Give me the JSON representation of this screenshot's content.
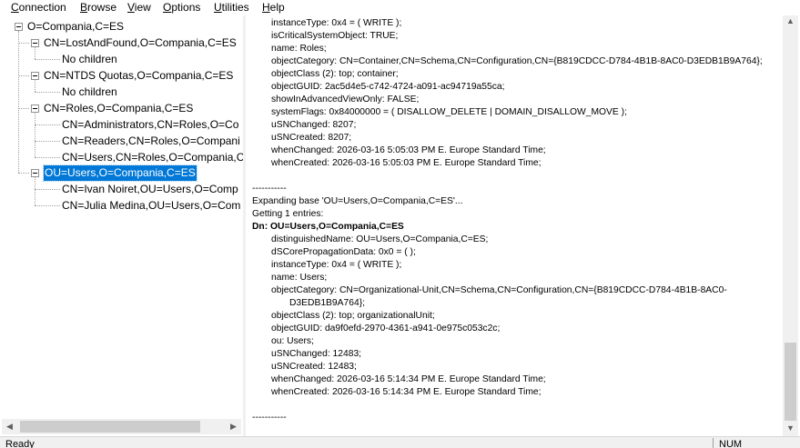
{
  "menu": [
    "Connection",
    "Browse",
    "View",
    "Options",
    "Utilities",
    "Help"
  ],
  "tree": {
    "root": "O=Compania,C=ES",
    "lostfound": "CN=LostAndFound,O=Compania,C=ES",
    "lostfound_child": "No children",
    "ntds": "CN=NTDS Quotas,O=Compania,C=ES",
    "ntds_child": "No children",
    "roles": "CN=Roles,O=Compania,C=ES",
    "roles_admins": "CN=Administrators,CN=Roles,O=Co",
    "roles_readers": "CN=Readers,CN=Roles,O=Compani",
    "roles_users": "CN=Users,CN=Roles,O=Compania,C",
    "users": "OU=Users,O=Compania,C=ES",
    "users_ivan": "CN=Ivan Noiret,OU=Users,O=Comp",
    "users_julia": "CN=Julia Medina,OU=Users,O=Com"
  },
  "output": {
    "lines": [
      "instanceType: 0x4 = ( WRITE );",
      "isCriticalSystemObject: TRUE;",
      "name: Roles;",
      "objectCategory: CN=Container,CN=Schema,CN=Configuration,CN={B819CDCC-D784-4B1B-8AC0-D3EDB1B9A764};",
      "objectClass (2): top; container;",
      "objectGUID: 2ac5d4e5-c742-4724-a091-ac94719a55ca;",
      "showInAdvancedViewOnly: FALSE;",
      "systemFlags: 0x84000000 = ( DISALLOW_DELETE | DOMAIN_DISALLOW_MOVE );",
      "uSNChanged: 8207;",
      "uSNCreated: 8207;",
      "whenChanged: 2026-03-16 5:05:03 PM E. Europe Standard Time;",
      "whenCreated: 2026-03-16 5:05:03 PM E. Europe Standard Time;",
      "-----------",
      "Expanding base 'OU=Users,O=Compania,C=ES'...",
      "Getting 1 entries:",
      "Dn: OU=Users,O=Compania,C=ES",
      "distinguishedName: OU=Users,O=Compania,C=ES;",
      "dSCorePropagationData: 0x0 = (  );",
      "instanceType: 0x4 = ( WRITE );",
      "name: Users;",
      "objectCategory: CN=Organizational-Unit,CN=Schema,CN=Configuration,CN={B819CDCC-D784-4B1B-8AC0-",
      "D3EDB1B9A764};",
      "objectClass (2): top; organizationalUnit;",
      "objectGUID: da9f0efd-2970-4361-a941-0e975c053c2c;",
      "ou: Users;",
      "uSNChanged: 12483;",
      "uSNCreated: 12483;",
      "whenChanged: 2026-03-16 5:14:34 PM E. Europe Standard Time;",
      "whenCreated: 2026-03-16 5:14:34 PM E. Europe Standard Time;",
      "-----------"
    ]
  },
  "status": {
    "text": "Ready",
    "num": "NUM"
  },
  "colors": {
    "selection": "#0078d7",
    "chrome": "#f0f0f0"
  }
}
